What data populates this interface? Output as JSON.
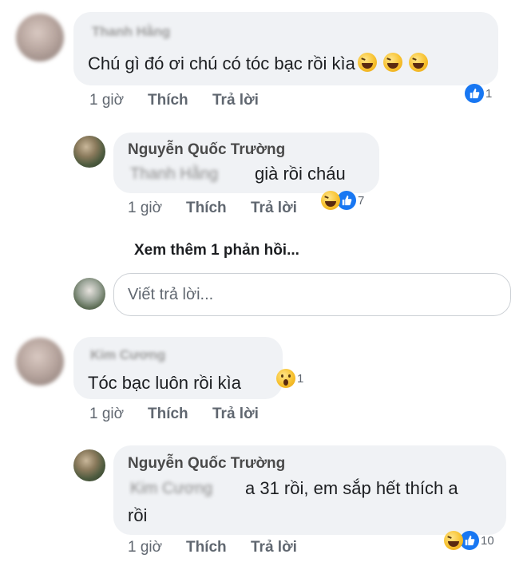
{
  "comments": [
    {
      "author": "Thanh Hằng",
      "text": "Chú gì đó ơi chú có tóc bạc rồi kìa",
      "time": "1 giờ",
      "like": "Thích",
      "reply": "Trả lời",
      "reaction_count": "1",
      "replies": [
        {
          "author": "Nguyễn Quốc Trường",
          "mention": "Thanh Hằng",
          "text": "già rồi cháu",
          "time": "1 giờ",
          "like": "Thích",
          "reply": "Trả lời",
          "reaction_count": "7"
        }
      ],
      "view_more": "Xem thêm 1 phản hồi...",
      "reply_placeholder": "Viết trả lời..."
    },
    {
      "author": "Kim Cương",
      "text": "Tóc bạc luôn rồi kìa",
      "time": "1 giờ",
      "like": "Thích",
      "reply": "Trả lời",
      "reaction_count": "1",
      "replies": [
        {
          "author": "Nguyễn Quốc Trường",
          "mention": "Kim Cương",
          "text_line1": "a 31 rồi, em sắp hết thích a",
          "text_line2": "rồi",
          "time": "1 giờ",
          "like": "Thích",
          "reply": "Trả lời",
          "reaction_count": "10"
        }
      ]
    }
  ],
  "colors": {
    "bubble": "#f0f2f5",
    "like_blue": "#1877f2",
    "meta_gray": "#606770",
    "emoji_yellow": "#f7c12e"
  },
  "icons": [
    "laughing-emoji-icon",
    "like-icon",
    "wow-emoji-icon",
    "haha-reaction-icon"
  ]
}
